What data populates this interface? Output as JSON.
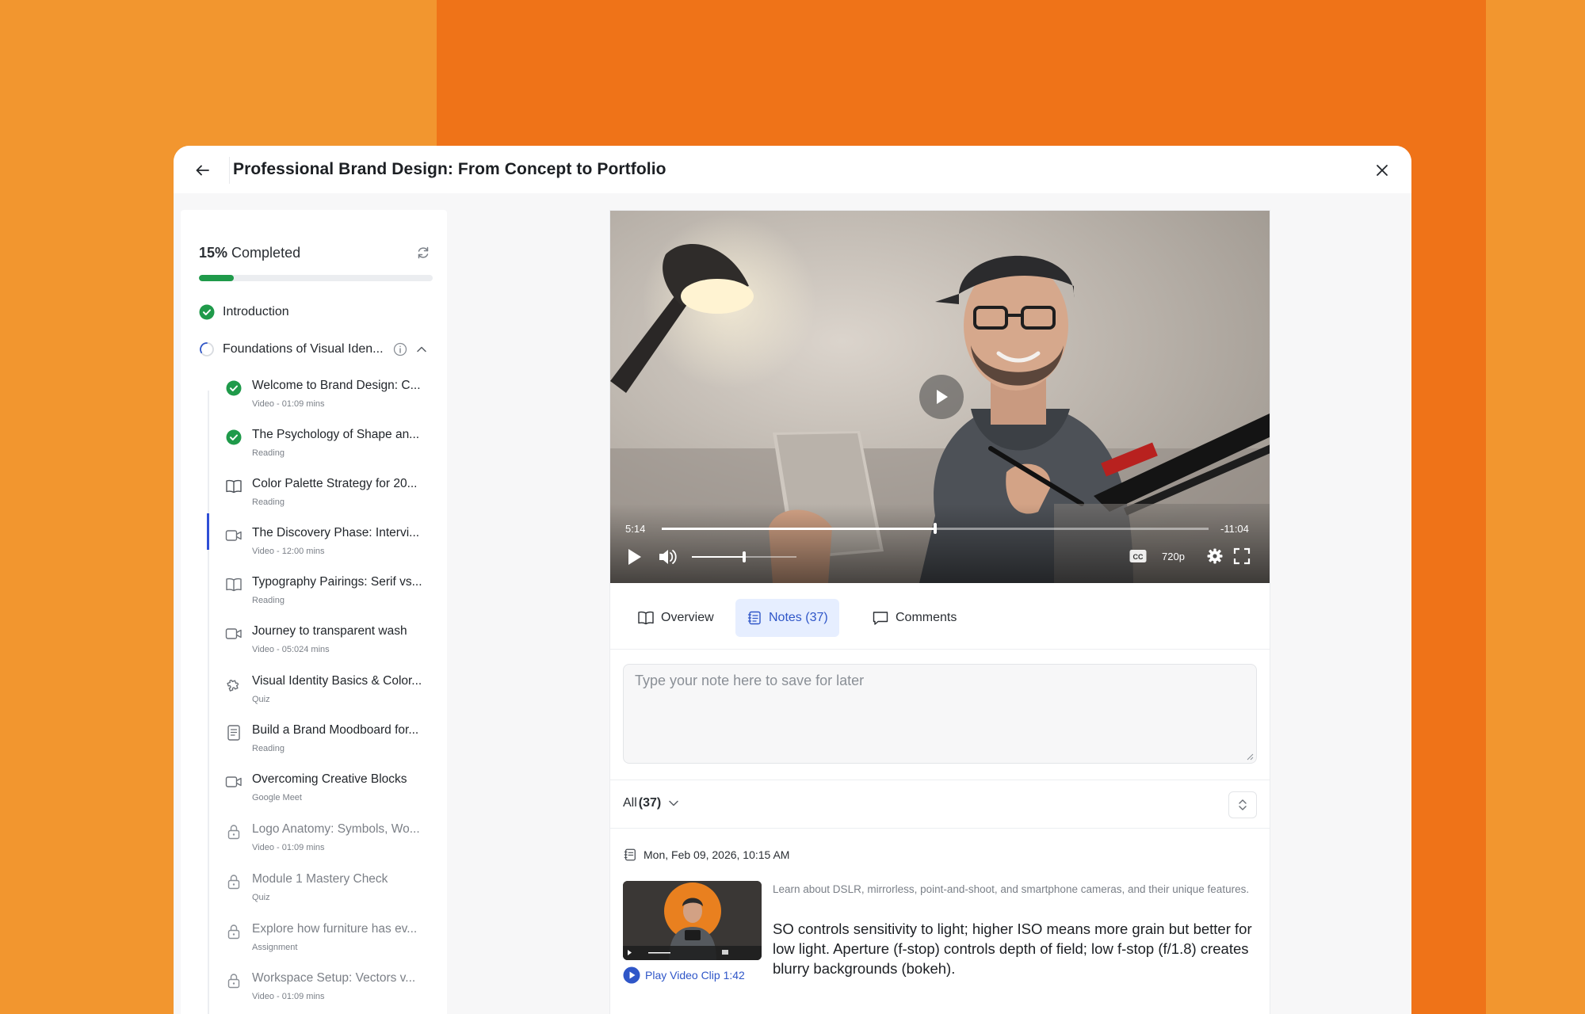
{
  "colors": {
    "accent": "#2f56c8",
    "success": "#1f9a4a",
    "background_left": "#F2962F",
    "background_center": "#EF7318"
  },
  "header": {
    "back_icon": "arrow-left-icon",
    "title": "Professional Brand Design: From Concept to Portfolio",
    "close_icon": "close-icon"
  },
  "sidebar": {
    "progress_percent_label": "15%",
    "progress_label": "Completed",
    "progress_value": 0.15,
    "refresh_icon": "refresh-icon",
    "sections": [
      {
        "label": "Introduction",
        "status": "completed"
      },
      {
        "label": "Foundations of Visual Iden...",
        "status": "in-progress"
      }
    ],
    "lessons": [
      {
        "title": "Welcome to Brand Design: C...",
        "meta": "Video - 01:09 mins",
        "icon": "check-circle-icon",
        "locked": false
      },
      {
        "title": "The Psychology of Shape an...",
        "meta": "Reading",
        "icon": "check-circle-icon",
        "locked": false
      },
      {
        "title": "Color Palette Strategy for 20...",
        "meta": "Reading",
        "icon": "book-icon",
        "locked": false
      },
      {
        "title": "The Discovery Phase: Intervi...",
        "meta": "Video - 12:00 mins",
        "icon": "video-icon",
        "locked": false
      },
      {
        "title": "Typography Pairings: Serif vs...",
        "meta": "Reading",
        "icon": "book-icon",
        "locked": false
      },
      {
        "title": "Journey to transparent wash",
        "meta": "Video - 05:024 mins",
        "icon": "video-icon",
        "locked": false
      },
      {
        "title": "Visual Identity Basics & Color...",
        "meta": "Quiz",
        "icon": "puzzle-icon",
        "locked": false
      },
      {
        "title": "Build a Brand Moodboard for...",
        "meta": "Reading",
        "icon": "document-icon",
        "locked": false
      },
      {
        "title": "Overcoming Creative Blocks",
        "meta": "Google Meet",
        "icon": "video-icon",
        "locked": false
      },
      {
        "title": "Logo Anatomy: Symbols, Wo...",
        "meta": "Video - 01:09 mins",
        "icon": "lock-icon",
        "locked": true
      },
      {
        "title": "Module 1 Mastery Check",
        "meta": "Quiz",
        "icon": "lock-icon",
        "locked": true
      },
      {
        "title": "Explore how furniture has ev...",
        "meta": "Assignment",
        "icon": "lock-icon",
        "locked": true
      },
      {
        "title": "Workspace Setup: Vectors v...",
        "meta": "Video - 01:09 mins",
        "icon": "lock-icon",
        "locked": true
      }
    ]
  },
  "video": {
    "elapsed": "5:14",
    "remaining": "-11:04",
    "progress": 0.5,
    "volume": 0.5,
    "quality": "720p"
  },
  "tabs": [
    {
      "label": "Overview",
      "icon": "book-icon",
      "active": false
    },
    {
      "label": "Notes (37)",
      "icon": "notes-icon",
      "active": true
    },
    {
      "label": "Comments",
      "icon": "comment-icon",
      "active": false
    }
  ],
  "notes": {
    "placeholder": "Type your note here to save for later",
    "filter_label": "All",
    "filter_count": "(37)",
    "items": [
      {
        "date": "Mon, Feb 09, 2026, 10:15 AM",
        "clip_label": "Play Video Clip 1:42",
        "context": "Learn about DSLR, mirrorless, point-and-shoot, and smartphone cameras, and their unique features.",
        "text": "SO controls sensitivity to light; higher ISO means more grain but better for low light. Aperture (f-stop) controls depth of field; low f-stop (f/1.8) creates blurry backgrounds (bokeh)."
      }
    ]
  }
}
